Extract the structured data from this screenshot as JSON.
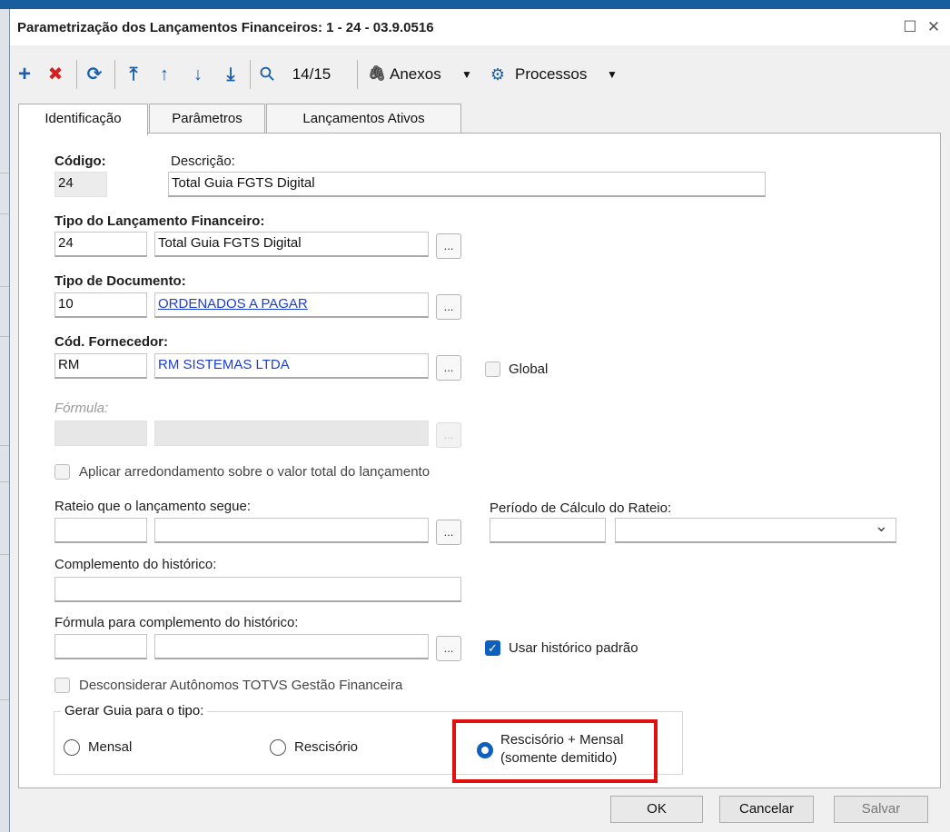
{
  "window": {
    "title": "Parametrização dos Lançamentos Financeiros: 1 - 24 - 03.9.0516",
    "maximize_glyph": "☐",
    "close_glyph": "✕"
  },
  "toolbar": {
    "add_glyph": "+",
    "delete_glyph": "✖",
    "refresh_glyph": "⟳",
    "first_glyph": "⤒",
    "prev_glyph": "↑",
    "next_glyph": "↓",
    "last_glyph": "⤓",
    "search_glyph": "⚲",
    "record_position": "14/15",
    "anexos_label": "Anexos",
    "processos_label": "Processos",
    "dropdown_glyph": "▼"
  },
  "tabs": [
    {
      "label": "Identificação",
      "active": true
    },
    {
      "label": "Parâmetros",
      "active": false
    },
    {
      "label": "Lançamentos Ativos",
      "active": false
    }
  ],
  "form": {
    "codigo_label": "Código:",
    "codigo_value": "24",
    "descricao_label": "Descrição:",
    "descricao_value": "Total Guia FGTS Digital",
    "tipo_lanc_label": "Tipo do Lançamento Financeiro:",
    "tipo_lanc_code": "24",
    "tipo_lanc_desc": "Total Guia FGTS Digital",
    "tipo_doc_label": "Tipo de Documento:",
    "tipo_doc_code": "10",
    "tipo_doc_desc": "ORDENADOS A PAGAR",
    "fornecedor_label": "Cód. Fornecedor:",
    "fornecedor_code": "RM",
    "fornecedor_desc": "RM SISTEMAS LTDA",
    "global_label": "Global",
    "formula_label": "Fórmula:",
    "arredondamento_label": "Aplicar arredondamento sobre o valor total do lançamento",
    "rateio_label": "Rateio que o lançamento segue:",
    "periodo_rateio_label": "Período de Cálculo do Rateio:",
    "complemento_label": "Complemento do histórico:",
    "formula_complemento_label": "Fórmula para complemento do histórico:",
    "usar_historico_label": "Usar histórico padrão",
    "desconsiderar_label": "Desconsiderar Autônomos TOTVS Gestão Financeira",
    "ellipsis": "...",
    "check_glyph": "✓",
    "chevron_glyph": "⌄"
  },
  "guia_group": {
    "title": "Gerar Guia para o tipo:",
    "options": [
      {
        "label": "Mensal",
        "selected": false
      },
      {
        "label": "Rescisório",
        "selected": false
      },
      {
        "label_line1": "Rescisório + Mensal",
        "label_line2": "(somente demitido)",
        "selected": true
      }
    ]
  },
  "buttons": {
    "ok": "OK",
    "cancelar": "Cancelar",
    "salvar": "Salvar"
  },
  "colors": {
    "accent": "#0f5fbf",
    "link": "#1b3fd2",
    "highlight": "#e01010",
    "delete_icon": "#d42020"
  }
}
